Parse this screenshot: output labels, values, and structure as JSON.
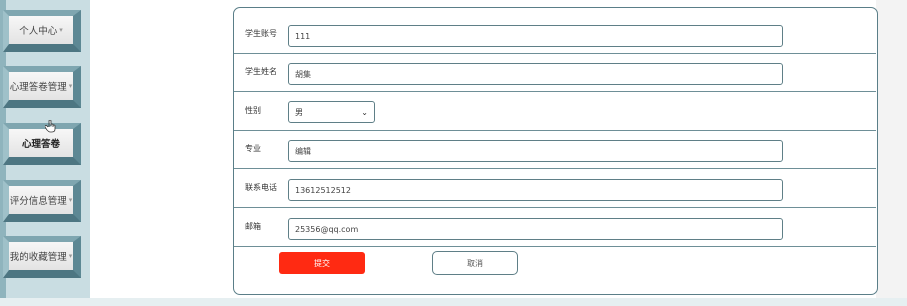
{
  "sidebar": {
    "items": [
      {
        "label": "个人中心",
        "caret": "▾"
      },
      {
        "label": "心理答卷管理",
        "caret": "▾"
      },
      {
        "label": "心理答卷",
        "caret": ""
      },
      {
        "label": "评分信息管理",
        "caret": "▾"
      },
      {
        "label": "我的收藏管理",
        "caret": "▾"
      }
    ],
    "active_item": "心理答卷"
  },
  "form": {
    "fields": [
      {
        "label": "学生账号",
        "value": "111"
      },
      {
        "label": "学生姓名",
        "value": "胡集"
      },
      {
        "label": "性别",
        "value": "男",
        "type": "select"
      },
      {
        "label": "专业",
        "value": "编辑"
      },
      {
        "label": "联系电话",
        "value": "13612512512"
      },
      {
        "label": "邮箱",
        "value": "25356@qq.com"
      }
    ],
    "submit_label": "提交",
    "cancel_label": "取消"
  },
  "colors": {
    "submit": "#ff2a12",
    "border": "#5a7e88",
    "sidebar": "#c9dde2"
  },
  "icons": {
    "cursor": "hand-pointer-icon",
    "select_arrow": "chevron-down-icon"
  }
}
